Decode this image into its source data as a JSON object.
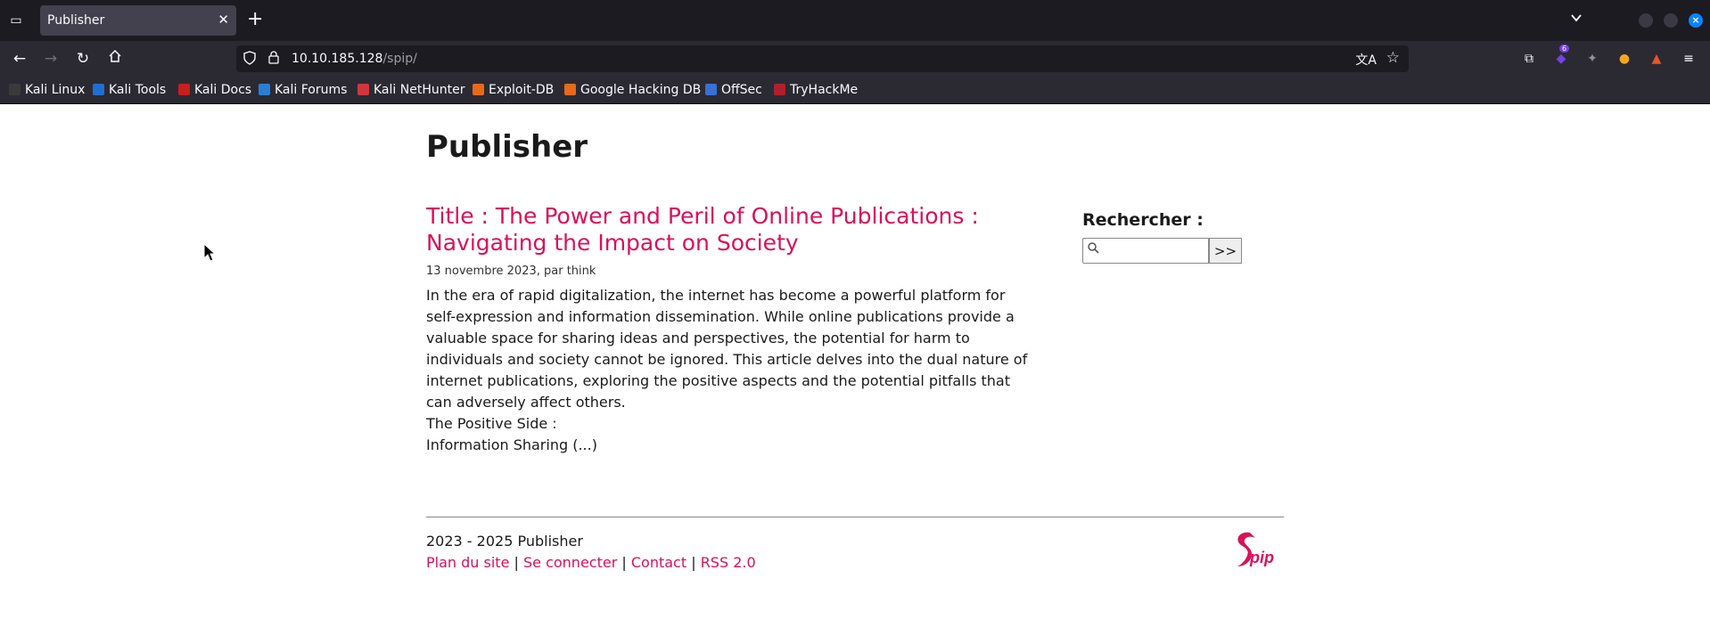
{
  "browser": {
    "tab": {
      "title": "Publisher"
    },
    "url": {
      "host": "10.10.185.128",
      "path": "/spip/"
    },
    "extensions_badge": "6",
    "bookmarks": [
      {
        "label": "Kali Linux",
        "color": "#3a3a3a"
      },
      {
        "label": "Kali Tools",
        "color": "#1f6fd1"
      },
      {
        "label": "Kali Docs",
        "color": "#c81e1e"
      },
      {
        "label": "Kali Forums",
        "color": "#2a7fd4"
      },
      {
        "label": "Kali NetHunter",
        "color": "#d1363c"
      },
      {
        "label": "Exploit-DB",
        "color": "#e66a1a"
      },
      {
        "label": "Google Hacking DB",
        "color": "#e66a1a"
      },
      {
        "label": "OffSec",
        "color": "#3b6fd6"
      },
      {
        "label": "TryHackMe",
        "color": "#b0202c"
      }
    ]
  },
  "page": {
    "site_title": "Publisher",
    "article": {
      "title": "Title : The Power and Peril of Online Publications : Navigating the Impact on Society",
      "info": "13 novembre 2023, par think",
      "intro": "In the era of rapid digitalization, the internet has become a powerful platform for self-expression and information dissemination. While online publications provide a valuable space for sharing ideas and perspectives, the potential for harm to individuals and society cannot be ignored. This article delves into the dual nature of internet publications, exploring the positive aspects and the potential pitfalls that can adversely affect others.",
      "line2": "The Positive Side :",
      "line3": "Information Sharing (...)"
    },
    "search": {
      "label": "Rechercher :",
      "button": ">>",
      "value": ""
    },
    "footer": {
      "copyright": "2023 - 2025 Publisher",
      "links": [
        "Plan du site",
        "Se connecter",
        "Contact",
        "RSS 2.0"
      ],
      "separator": "|"
    },
    "accent_color": "#d9115a"
  }
}
